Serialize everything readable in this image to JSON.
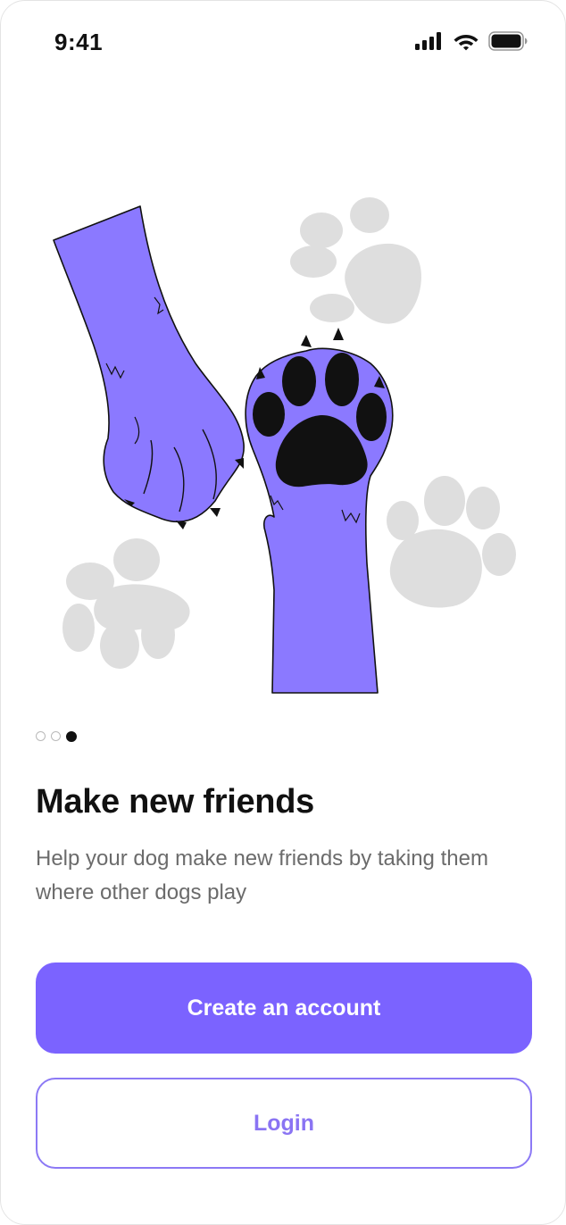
{
  "status_bar": {
    "time": "9:41",
    "icons": [
      "signal-icon",
      "wifi-icon",
      "battery-icon"
    ]
  },
  "illustration": {
    "subject": "dog-paws-icon",
    "colors": {
      "paw": "#8b79ff",
      "outline": "#111111",
      "pad": "#111111",
      "background_paw_prints": "#dedede"
    }
  },
  "pager": {
    "total": 3,
    "active_index": 2
  },
  "content": {
    "title": "Make new friends",
    "description": "Help your dog make new friends by taking them where other dogs play"
  },
  "actions": {
    "create_account_label": "Create an account",
    "login_label": "Login"
  },
  "colors": {
    "primary": "#7b63ff",
    "primary_text": "#ffffff",
    "secondary_border": "#8c79f5",
    "secondary_text": "#8a74f3",
    "title": "#111111",
    "body_text": "#6b6b6b"
  }
}
